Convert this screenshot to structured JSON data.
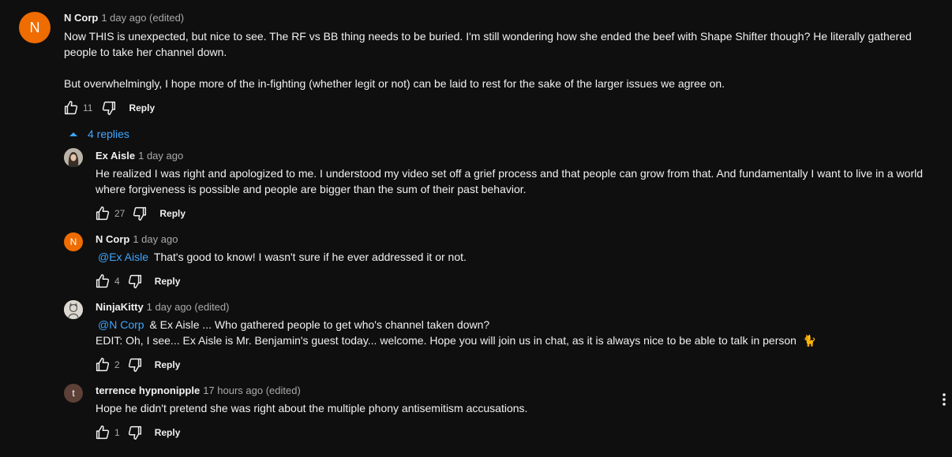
{
  "top_comment": {
    "avatar_letter": "N",
    "avatar_color": "#ef6c00",
    "author": "N Corp",
    "meta": "1 day ago (edited)",
    "line1": "Now THIS is unexpected, but nice to see. The RF vs BB thing needs to be buried. I'm still wondering how she ended the beef with Shape Shifter though? He literally gathered",
    "line2": "people to take her channel down.",
    "line3": "But overwhelmingly, I hope more of the in-fighting (whether legit or not) can be laid to rest for the sake of the larger issues we agree on.",
    "likes": "11",
    "reply_label": "Reply"
  },
  "replies_toggle": {
    "label": "4 replies",
    "icon": "caret-up-icon"
  },
  "replies": [
    {
      "author": "Ex Aisle",
      "meta": "1 day ago",
      "avatar_type": "photo",
      "line1": "He realized I was right and apologized to me. I understood my video set off a grief process and that people can grow from that.  And fundamentally I want to live in a world",
      "line2": "where forgiveness is possible and people are bigger than the sum of their past behavior.",
      "likes": "27",
      "reply_label": "Reply"
    },
    {
      "author": "N Corp",
      "meta": "1 day ago",
      "avatar_letter": "N",
      "avatar_color": "#ef6c00",
      "mention": "@Ex Aisle",
      "line1": "That's good to know! I wasn't sure if he ever addressed it or not.",
      "likes": "4",
      "reply_label": "Reply"
    },
    {
      "author": "NinjaKitty",
      "meta": "1 day ago (edited)",
      "avatar_type": "drawing",
      "mention": "@N Corp",
      "line1": "& Ex Aisle ... Who gathered people to get who's channel taken down?",
      "line2": "EDIT: Oh, I see... Ex Aisle is Mr. Benjamin's guest today... welcome. Hope you will join us in chat, as it is always nice to be able to talk in person",
      "emoji": "🐈",
      "likes": "2",
      "reply_label": "Reply"
    },
    {
      "author": "terrence hypnonipple",
      "meta": "17 hours ago (edited)",
      "avatar_letter": "t",
      "avatar_color": "#5d4037",
      "line1": "Hope he didn't pretend she was right about the multiple phony antisemitism accusations.",
      "likes": "1",
      "reply_label": "Reply"
    }
  ],
  "menu": {
    "icon": "more-vert-icon"
  },
  "colors": {
    "background": "#0f0f0f",
    "link": "#3ea6ff",
    "secondary_text": "#aaaaaa"
  }
}
